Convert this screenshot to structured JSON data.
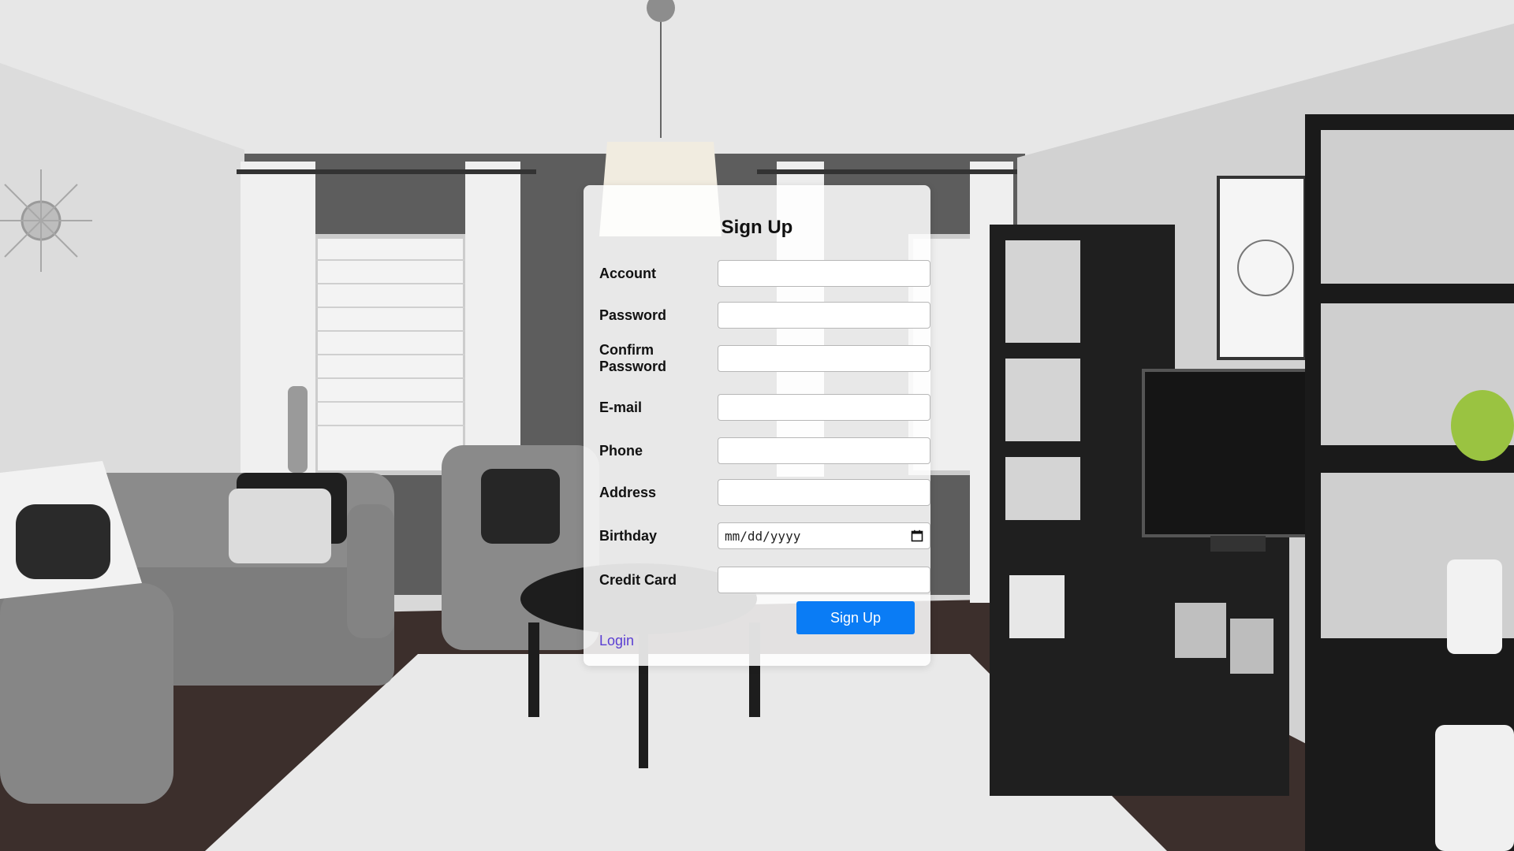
{
  "form": {
    "title": "Sign Up",
    "fields": [
      {
        "label": "Account",
        "value": "",
        "type": "text"
      },
      {
        "label": "Password",
        "value": "",
        "type": "password"
      },
      {
        "label": "Confirm Password",
        "value": "",
        "type": "password"
      },
      {
        "label": "E-mail",
        "value": "",
        "type": "email"
      },
      {
        "label": "Phone",
        "value": "",
        "type": "tel"
      },
      {
        "label": "Address",
        "value": "",
        "type": "text"
      },
      {
        "label": "Birthday",
        "value": "",
        "placeholder": "mm/dd/yyyy",
        "type": "date"
      },
      {
        "label": "Credit Card",
        "value": "",
        "type": "text"
      }
    ],
    "submit_label": "Sign Up",
    "login_label": "Login"
  },
  "icons": {
    "date_picker": "calendar-icon"
  },
  "colors": {
    "accent": "#0a7cf5",
    "link": "#5a3fd3",
    "card_background": "#ffffff"
  }
}
